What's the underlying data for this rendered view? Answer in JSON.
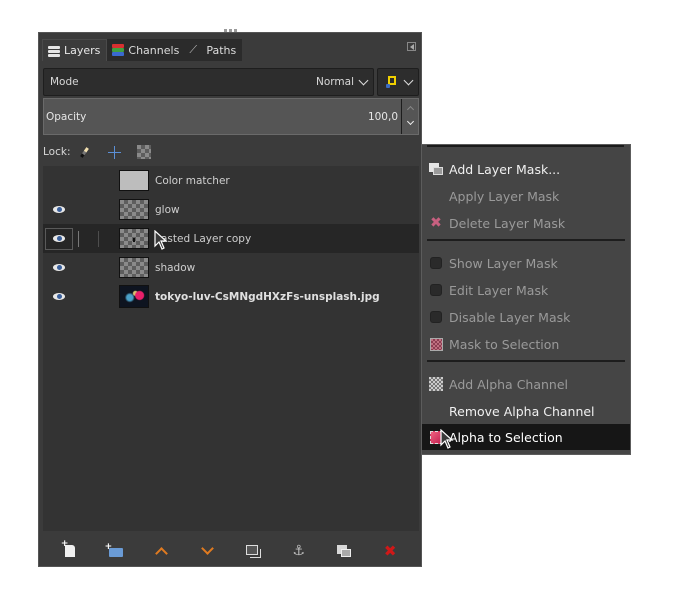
{
  "dock": {
    "tabs": [
      {
        "label": "Layers",
        "icon": "layers-icon",
        "active": true
      },
      {
        "label": "Channels",
        "icon": "channels-icon",
        "active": false
      },
      {
        "label": "Paths",
        "icon": "paths-icon",
        "active": false
      }
    ],
    "mode": {
      "label": "Mode",
      "value": "Normal"
    },
    "opacity": {
      "label": "Opacity",
      "value": "100,0"
    },
    "lock": {
      "label": "Lock:",
      "items": [
        "lock-pixels-icon",
        "lock-position-icon",
        "lock-alpha-icon"
      ]
    },
    "layers": [
      {
        "name": "Color matcher",
        "visible": false,
        "thumbnail": "plain",
        "bold": false,
        "selected": false
      },
      {
        "name": "glow",
        "visible": true,
        "thumbnail": "transparent",
        "bold": false,
        "selected": false
      },
      {
        "name": "Pasted Layer copy",
        "display_name": "asted Layer copy",
        "visible": true,
        "thumbnail": "transparent",
        "bold": false,
        "selected": true
      },
      {
        "name": "shadow",
        "visible": true,
        "thumbnail": "transparent",
        "bold": false,
        "selected": false
      },
      {
        "name": "tokyo-luv-CsMNgdHXzFs-unsplash.jpg",
        "visible": true,
        "thumbnail": "photo",
        "bold": true,
        "selected": false
      }
    ],
    "bottom_buttons": [
      {
        "name": "new-layer",
        "icon": "new-layer-icon"
      },
      {
        "name": "new-layer-group",
        "icon": "new-group-icon"
      },
      {
        "name": "raise-layer",
        "icon": "arrow-up-icon"
      },
      {
        "name": "lower-layer",
        "icon": "arrow-down-icon"
      },
      {
        "name": "duplicate-layer",
        "icon": "duplicate-icon"
      },
      {
        "name": "anchor-layer",
        "icon": "anchor-icon"
      },
      {
        "name": "add-mask",
        "icon": "mask-icon"
      },
      {
        "name": "delete-layer",
        "icon": "delete-icon"
      }
    ]
  },
  "context_menu": {
    "items": [
      {
        "label": "Add Layer Mask...",
        "icon": "add-mask-icon",
        "enabled": true
      },
      {
        "label": "Apply Layer Mask",
        "icon": "",
        "enabled": false
      },
      {
        "label": "Delete Layer Mask",
        "icon": "delete-mask-icon",
        "enabled": false
      },
      {
        "label": "Show Layer Mask",
        "icon": "checkbox",
        "enabled": false
      },
      {
        "label": "Edit Layer Mask",
        "icon": "checkbox",
        "enabled": false
      },
      {
        "label": "Disable Layer Mask",
        "icon": "checkbox",
        "enabled": false
      },
      {
        "label": "Mask to Selection",
        "icon": "mask-to-selection-icon",
        "enabled": false
      },
      {
        "label": "Add Alpha Channel",
        "icon": "add-alpha-icon",
        "enabled": false
      },
      {
        "label": "Remove Alpha Channel",
        "icon": "",
        "enabled": true
      },
      {
        "label": "Alpha to Selection",
        "icon": "alpha-to-selection-icon",
        "enabled": true,
        "highlighted": true
      }
    ]
  },
  "colors": {
    "panel_bg": "#3b3b3b",
    "menu_bg": "#454545",
    "highlight_bg": "#161616",
    "accent_orange": "#e07a20",
    "delete_red": "#d01818"
  }
}
